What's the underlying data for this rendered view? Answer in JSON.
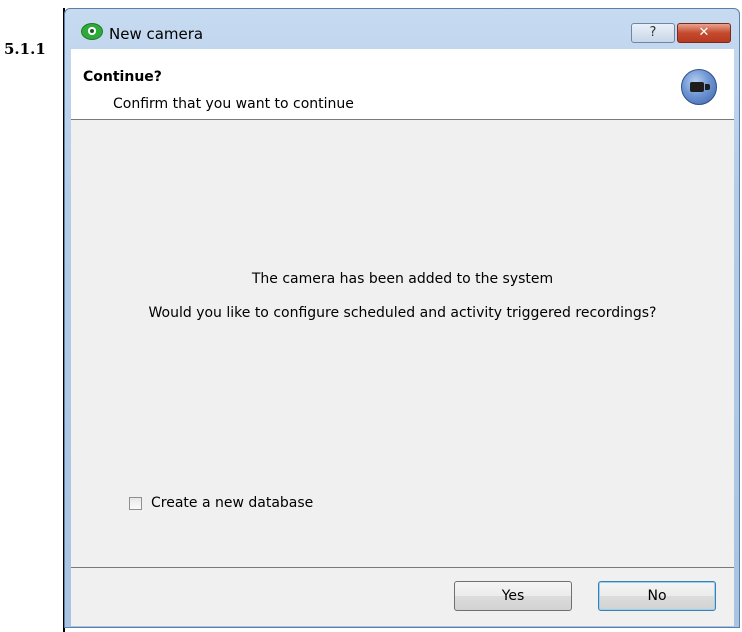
{
  "section_number": "5.1.1",
  "window": {
    "title": "New camera",
    "help_button": "?",
    "close_button": "✕"
  },
  "header": {
    "title": "Continue?",
    "subtitle": "Confirm that you want to continue"
  },
  "body": {
    "message_line1": "The camera has been added to the system",
    "message_line2": "Would you like to configure scheduled and activity triggered recordings?",
    "checkbox_label": "Create a new database",
    "checkbox_checked": false
  },
  "buttons": {
    "yes": "Yes",
    "no": "No"
  },
  "icons": [
    "eye-icon",
    "help-icon",
    "close-icon",
    "camera-icon"
  ]
}
